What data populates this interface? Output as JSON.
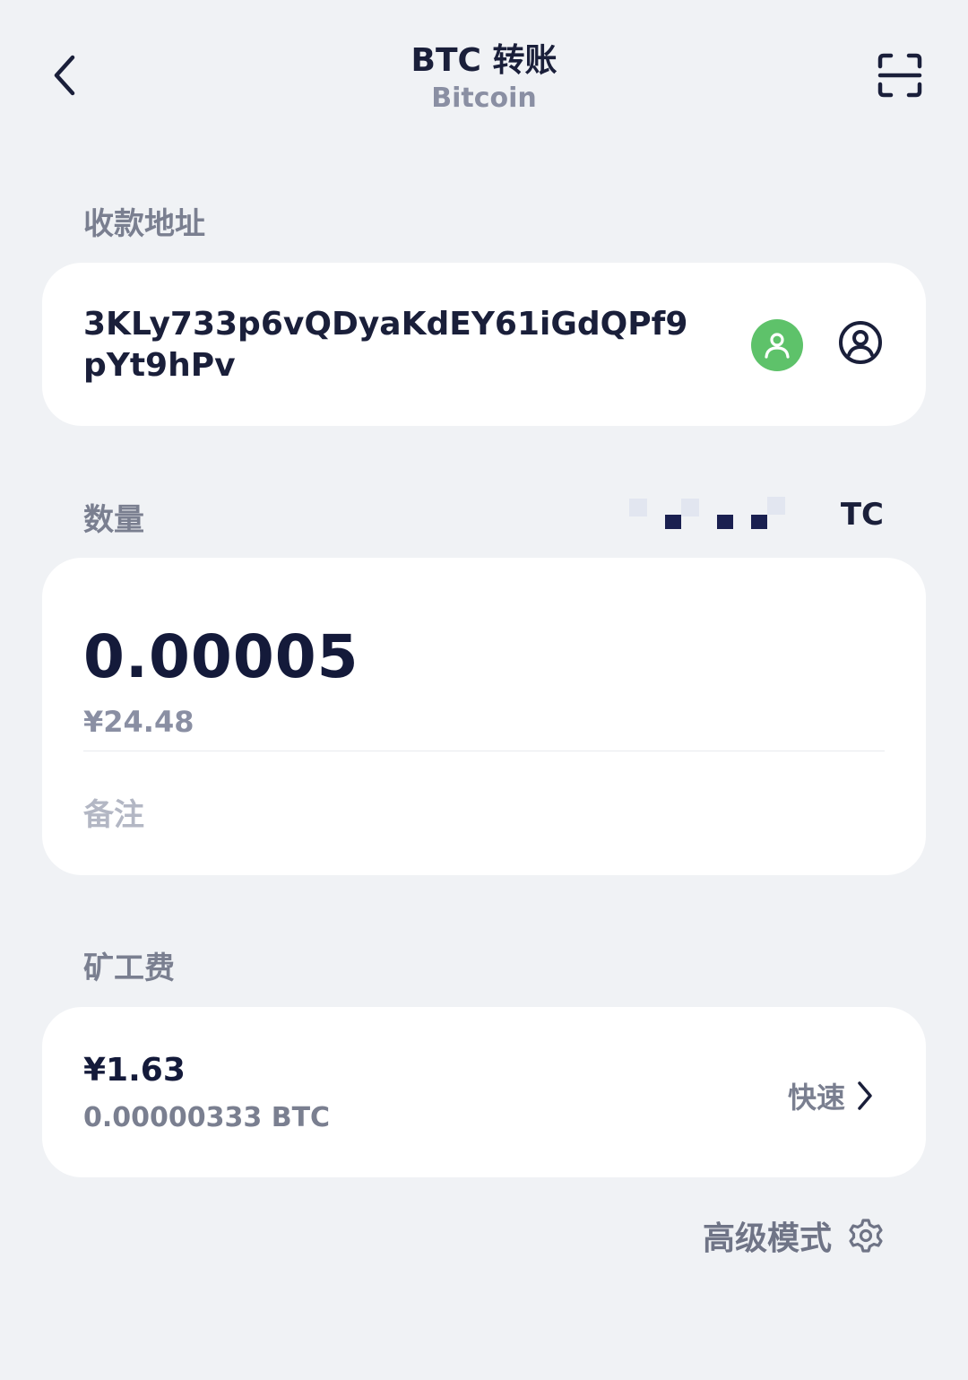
{
  "header": {
    "title": "BTC 转账",
    "subtitle": "Bitcoin"
  },
  "icons": {
    "back": "chevron-left-icon",
    "scan": "scan-icon",
    "contact": "contact-icon",
    "account": "account-circle-icon",
    "chevron": "chevron-right-icon",
    "settings": "gear-icon"
  },
  "address_section": {
    "label": "收款地址",
    "address": "3KLy733p6vQDyaKdEY61iGdQPf9pYt9hPv"
  },
  "amount_section": {
    "label": "数量",
    "balance_suffix": "TC",
    "amount": "0.00005",
    "fiat_value": "¥24.48",
    "memo_placeholder": "备注"
  },
  "fee_section": {
    "label": "矿工费",
    "fiat": "¥1.63",
    "btc": "0.00000333 BTC",
    "speed": "快速"
  },
  "advanced": {
    "label": "高级模式"
  },
  "colors": {
    "background": "#f0f2f5",
    "card": "#ffffff",
    "primary_text": "#1a1f3a",
    "secondary_text": "#7a7f90",
    "contact_green": "#5ec26a"
  }
}
